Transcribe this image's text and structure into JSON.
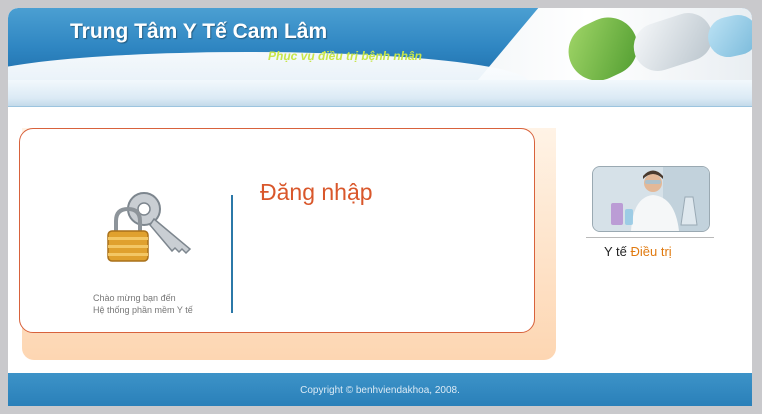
{
  "header": {
    "title": "Trung Tâm Y Tế Cam Lâm",
    "subtitle": "Phục vụ điều trị bệnh nhân"
  },
  "login": {
    "title": "Đăng nhập",
    "welcome_line1": "Chào mừng bạn đến",
    "welcome_line2": "Hệ thống phần mềm Y tế"
  },
  "sidebar": {
    "link_prefix": "Y tế",
    "link_accent": "Điều trị"
  },
  "footer": {
    "copyright": "Copyright © benhviendakhoa, 2008."
  },
  "colors": {
    "brand_blue": "#2f86c2",
    "accent_orange": "#d9572b",
    "subtitle_green": "#c8e64b"
  },
  "icons": {
    "login_graphic": "key-lock-icon",
    "banner_graphic": "pills-graphic",
    "photo": "lab-worker-photo"
  }
}
